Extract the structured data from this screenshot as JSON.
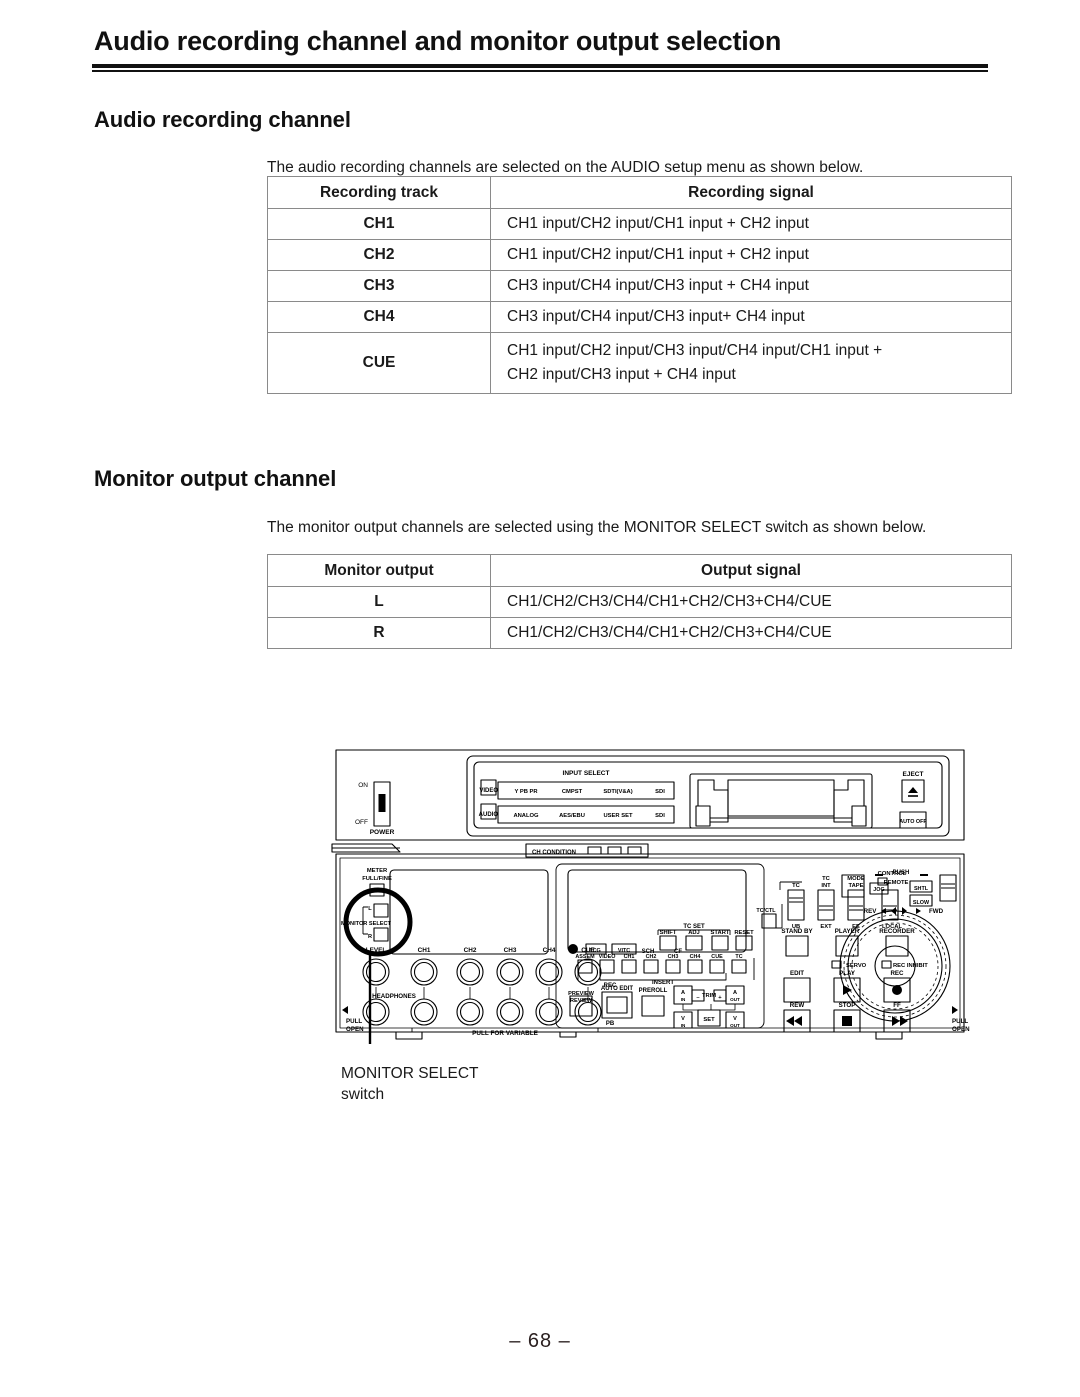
{
  "document": {
    "title": "Audio recording channel and monitor output selection",
    "page_number": "– 68 –"
  },
  "sections": {
    "audio_recording": {
      "heading": "Audio recording channel",
      "intro": "The audio recording channels are selected on the AUDIO setup menu as shown below.",
      "table": {
        "headers": [
          "Recording track",
          "Recording signal"
        ],
        "rows": [
          {
            "track": "CH1",
            "signal": "CH1 input/CH2 input/CH1 input + CH2 input",
            "signal_line2": ""
          },
          {
            "track": "CH2",
            "signal": "CH1 input/CH2 input/CH1 input + CH2 input",
            "signal_line2": ""
          },
          {
            "track": "CH3",
            "signal": "CH3 input/CH4 input/CH3 input + CH4 input",
            "signal_line2": ""
          },
          {
            "track": "CH4",
            "signal": "CH3 input/CH4 input/CH3  input+ CH4 input",
            "signal_line2": ""
          },
          {
            "track": "CUE",
            "signal": "CH1 input/CH2 input/CH3 input/CH4 input/CH1 input +",
            "signal_line2": "CH2 input/CH3 input + CH4 input"
          }
        ]
      }
    },
    "monitor_output": {
      "heading": "Monitor output channel",
      "intro": "The monitor output channels are selected using the MONITOR SELECT switch as shown below.",
      "table": {
        "headers": [
          "Monitor output",
          "Output signal"
        ],
        "rows": [
          {
            "track": "L",
            "signal": "CH1/CH2/CH3/CH4/CH1+CH2/CH3+CH4/CUE"
          },
          {
            "track": "R",
            "signal": "CH1/CH2/CH3/CH4/CH1+CH2/CH3+CH4/CUE"
          }
        ]
      }
    }
  },
  "figure": {
    "callout_line1": "MONITOR SELECT",
    "callout_line2": "switch",
    "labels": {
      "power_on": "ON",
      "power_off": "OFF",
      "power": "POWER",
      "input_select": "INPUT SELECT",
      "video": "VIDEO",
      "audio": "AUDIO",
      "video_opt1": "Y PB PR",
      "video_opt2": "CMPST",
      "video_opt3": "SDTI(V&A)",
      "video_opt4": "SDI",
      "audio_opt1": "ANALOG",
      "audio_opt2": "AES/EBU",
      "audio_opt3": "USER SET",
      "audio_opt4": "SDI",
      "ch_condition": "CH CONDITION",
      "eject": "EJECT",
      "auto_off": "AUTO OFF",
      "meter": "METER",
      "full_fine": "FULL/FINE",
      "monitor_select": "MONITOR SELECT",
      "monitor_l": "L",
      "monitor_r": "R",
      "level": "LEVEL",
      "ch1": "CH1",
      "ch2": "CH2",
      "ch3": "CH3",
      "ch4": "CH4",
      "cue": "CUE",
      "rec": "REC",
      "pb": "PB",
      "headphones": "HEADPHONES",
      "pull": "PULL",
      "open": "OPEN",
      "pull_for_variable": "PULL FOR VARIABLE",
      "sch": "SCH",
      "cf": "CF",
      "tc": "TC",
      "tcg": "TCG",
      "vitc": "VITC",
      "assem": "ASSEM",
      "insert": "INSERT",
      "tc_set": "TC SET",
      "shift": "SHIFT",
      "adj": "ADJ",
      "start": "START",
      "reset": "RESET",
      "preview": "PREVIEW",
      "review": "REVIEW",
      "auto_edit": "AUTO EDIT",
      "preroll": "PREROLL",
      "a_in": "A",
      "a_in_sub": "IN",
      "a_out": "A",
      "a_out_sub": "OUT",
      "v_in": "V",
      "v_in_sub": "IN",
      "v_out": "V",
      "v_out_sub": "OUT",
      "trim": "TRIM",
      "trim_minus": "–",
      "trim_plus": "+",
      "set": "SET",
      "tc_ctl": "TC/CTL",
      "tc_sw": "TC",
      "ub": "UB",
      "tc_mode": "TC",
      "int": "INT",
      "ext": "EXT",
      "mode": "MODE",
      "tape": "TAPE",
      "ee": "EE",
      "control": "CONTROL",
      "remote": "REMOTE",
      "local": "LOCAL",
      "stand_by": "STAND BY",
      "player": "PLAYER",
      "recorder": "RECORDER",
      "servo": "SERVO",
      "rec_inhibit": "REC INHIBIT",
      "edit": "EDIT",
      "play": "PLAY",
      "rec_btn": "REC",
      "rew": "REW",
      "stop": "STOP",
      "ff": "FF",
      "push": "PUSH",
      "jog": "JOG",
      "shtl": "SHTL",
      "slow": "SLOW",
      "rev": "REV",
      "fwd": "FWD",
      "pull_right": "PULL",
      "open_right": "OPEN"
    }
  }
}
